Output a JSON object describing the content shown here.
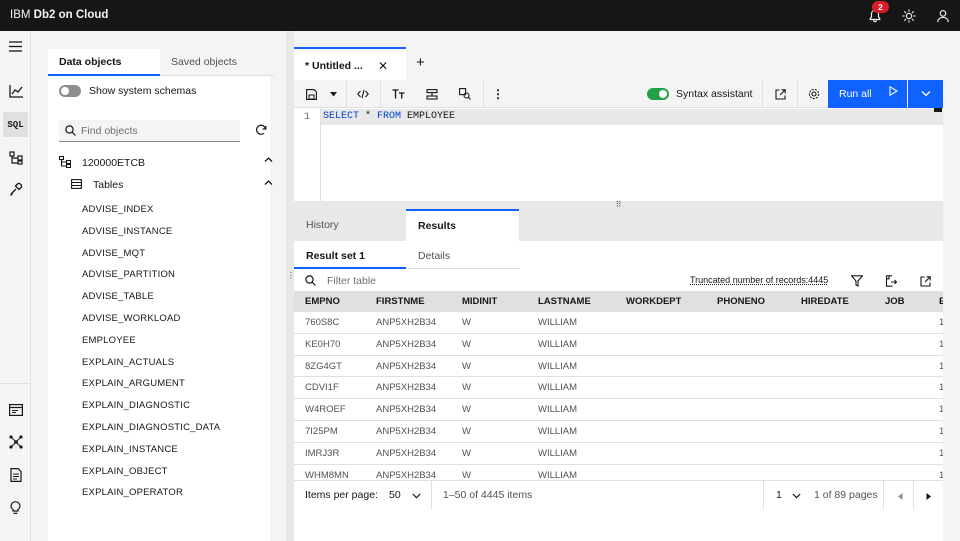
{
  "header": {
    "brand_prefix": "IBM",
    "brand_product": "Db2 on Cloud",
    "notification_count": "2"
  },
  "rail": {
    "icons": [
      "menu-icon",
      "chart-icon",
      "sql-icon",
      "schema-icon",
      "tools-icon",
      "terminal-icon",
      "network-icon",
      "document-icon",
      "lightbulb-icon"
    ],
    "sql_label": "SQL",
    "active": "sql"
  },
  "explorer": {
    "tabs": [
      "Data objects",
      "Saved objects"
    ],
    "show_system_schemas_label": "Show system schemas",
    "show_system_schemas_on": false,
    "search_placeholder": "Find objects",
    "schema": "120000ETCB",
    "tables_label": "Tables",
    "tables": [
      "ADVISE_INDEX",
      "ADVISE_INSTANCE",
      "ADVISE_MQT",
      "ADVISE_PARTITION",
      "ADVISE_TABLE",
      "ADVISE_WORKLOAD",
      "EMPLOYEE",
      "EXPLAIN_ACTUALS",
      "EXPLAIN_ARGUMENT",
      "EXPLAIN_DIAGNOSTIC",
      "EXPLAIN_DIAGNOSTIC_DATA",
      "EXPLAIN_INSTANCE",
      "EXPLAIN_OBJECT",
      "EXPLAIN_OPERATOR"
    ]
  },
  "editor": {
    "tab_title": "* Untitled ...",
    "syntax_assistant_label": "Syntax assistant",
    "syntax_assistant_on": true,
    "run_label": "Run all",
    "line_number": "1",
    "code": {
      "kw1": "SELECT",
      "star": " * ",
      "kw2": "FROM",
      "table": " EMPLOYEE"
    }
  },
  "results": {
    "tabs": [
      "History",
      "Results"
    ],
    "subtabs": [
      "Result set 1",
      "Details"
    ],
    "filter_placeholder": "Filter table",
    "truncated_text": "Truncated number of records:4445",
    "columns": [
      "EMPNO",
      "FIRSTNME",
      "MIDINIT",
      "LASTNAME",
      "WORKDEPT",
      "PHONENO",
      "HIREDATE",
      "JOB",
      "E"
    ],
    "rows": [
      [
        "760S8C",
        "ANP5XH2B34",
        "W",
        "WILLIAM",
        "1"
      ],
      [
        "KE0H70",
        "ANP5XH2B34",
        "W",
        "WILLIAM",
        "1"
      ],
      [
        "8ZG4GT",
        "ANP5XH2B34",
        "W",
        "WILLIAM",
        "1"
      ],
      [
        "CDVI1F",
        "ANP5XH2B34",
        "W",
        "WILLIAM",
        "1"
      ],
      [
        "W4ROEF",
        "ANP5XH2B34",
        "W",
        "WILLIAM",
        "1"
      ],
      [
        "7I25PM",
        "ANP5XH2B34",
        "W",
        "WILLIAM",
        "1"
      ],
      [
        "IMRJ3R",
        "ANP5XH2B34",
        "W",
        "WILLIAM",
        "1"
      ],
      [
        "WHM8MN",
        "ANP5XH2B34",
        "W",
        "WILLIAM",
        "1"
      ]
    ],
    "pager": {
      "items_per_page_label": "Items per page:",
      "items_per_page": "50",
      "range_text": "1–50 of 4445 items",
      "page": "1",
      "pages_text": "1 of 89 pages"
    }
  },
  "colors": {
    "accent": "#0f62fe",
    "header_bg": "#161616",
    "toggle_on": "#24a148",
    "badge": "#da1e28"
  }
}
